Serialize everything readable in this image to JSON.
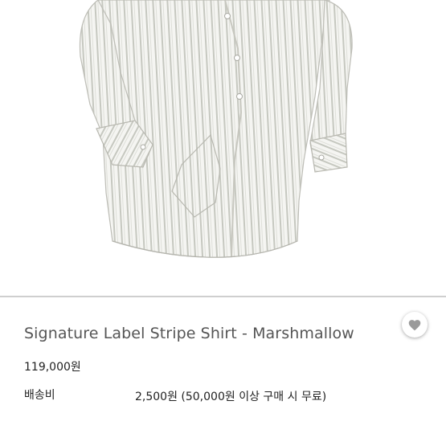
{
  "product": {
    "title": "Signature Label Stripe Shirt - Marshmallow",
    "price": "119,000원",
    "shipping_label": "배송비",
    "shipping_value": "2,500원 (50,000원 이상 구매 시 무료)"
  },
  "favorite": {
    "icon": "heart-icon"
  },
  "colors": {
    "shirt_base": "#f4f4f1",
    "stripe": "#c9cbc4",
    "divider": "#cfcfcf",
    "heart": "#9a9a9a"
  }
}
